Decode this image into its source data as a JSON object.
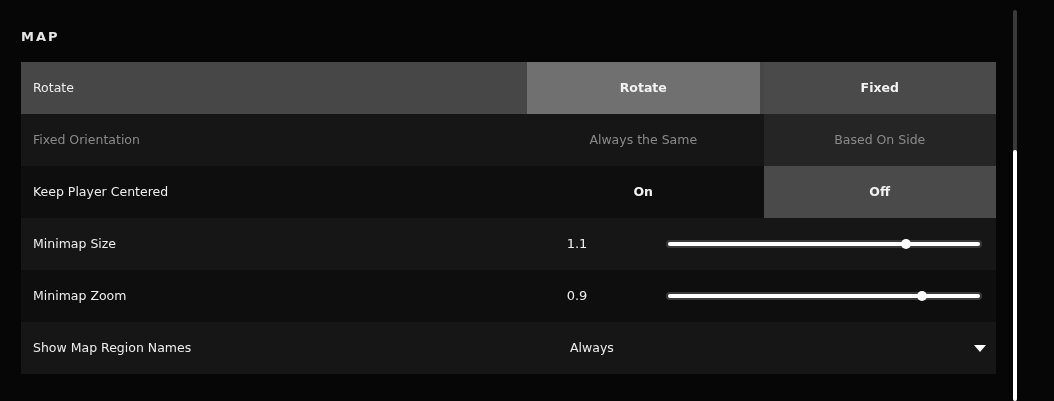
{
  "section": {
    "title": "MAP"
  },
  "rows": [
    {
      "kind": "toggle",
      "label": "Rotate",
      "highlighted": true,
      "disabled": false,
      "options": [
        {
          "label": "Rotate",
          "selected": true
        },
        {
          "label": "Fixed",
          "selected": false
        }
      ]
    },
    {
      "kind": "toggle",
      "label": "Fixed Orientation",
      "highlighted": false,
      "disabled": true,
      "options": [
        {
          "label": "Always the Same",
          "selected": false
        },
        {
          "label": "Based On Side",
          "selected": true
        }
      ]
    },
    {
      "kind": "toggle",
      "label": "Keep Player Centered",
      "highlighted": false,
      "disabled": false,
      "options": [
        {
          "label": "On",
          "selected": false
        },
        {
          "label": "Off",
          "selected": true
        }
      ]
    },
    {
      "kind": "slider",
      "label": "Minimap Size",
      "reading": "1.1",
      "level": 0.76
    },
    {
      "kind": "slider",
      "label": "Minimap Zoom",
      "reading": "0.9",
      "level": 0.81
    },
    {
      "kind": "dropdown",
      "label": "Show Map Region Names",
      "value": "Always"
    }
  ]
}
